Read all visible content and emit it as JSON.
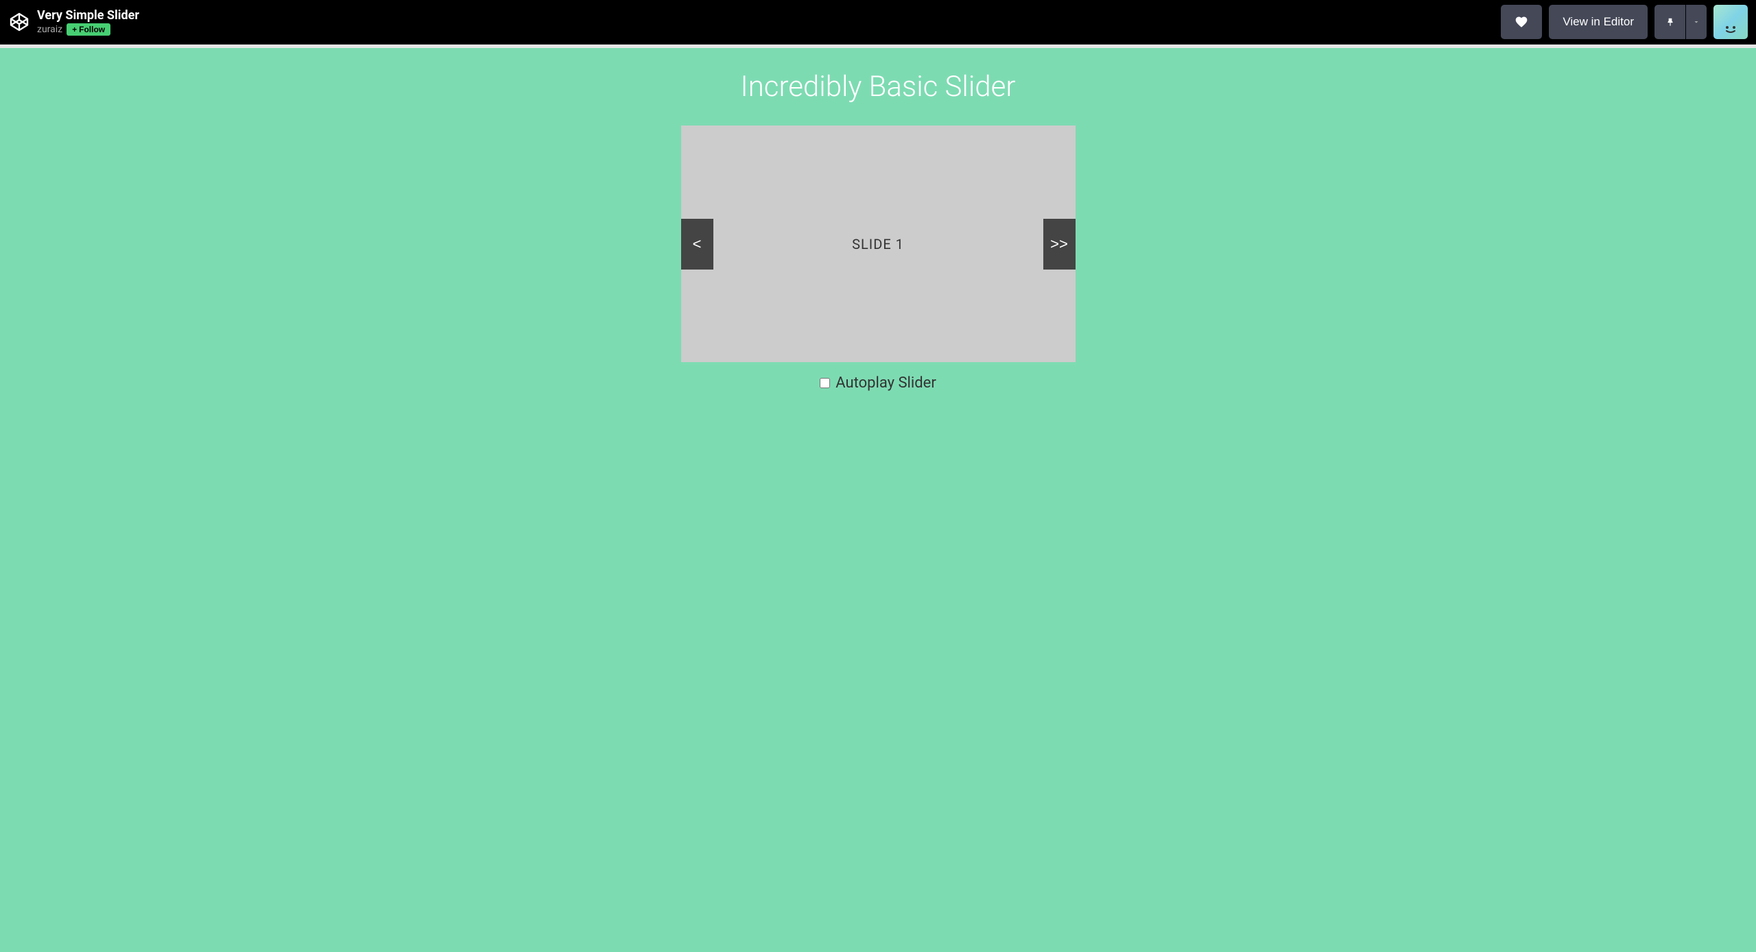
{
  "header": {
    "pen_title": "Very Simple Slider",
    "author": "zuraiz",
    "follow_label": "Follow",
    "view_editor_label": "View in Editor"
  },
  "content": {
    "title": "Incredibly Basic Slider",
    "slide_label": "SLIDE 1",
    "prev_arrow": "<",
    "next_arrow": ">>",
    "autoplay_label": "Autoplay Slider",
    "autoplay_checked": false
  }
}
